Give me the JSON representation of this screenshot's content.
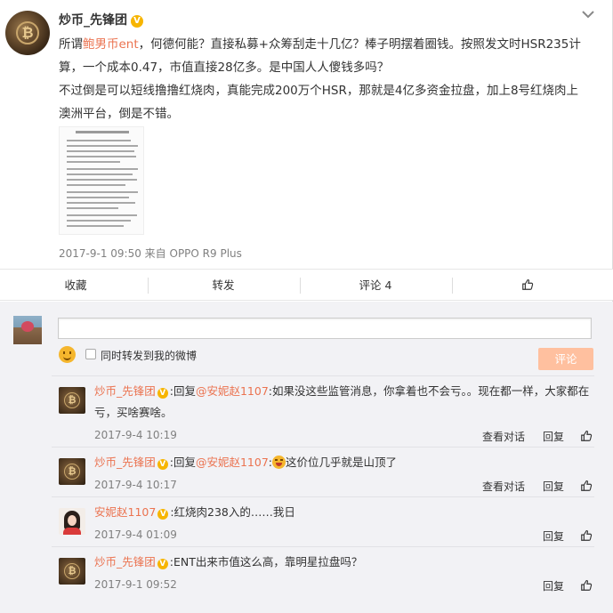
{
  "post": {
    "author": "炒币_先锋团",
    "verified_badge": "V",
    "text_intro": "所谓",
    "text_highlight": "鲍男币ent",
    "text_line1_rest": "，何德何能？直接私募+众筹刮走十几亿？棒子明摆着圈钱。按照发文时HSR235计",
    "text_line2": "算，一个成本0.47，市值直接28亿多。是中国人人傻钱多吗？",
    "text_line3": "不过倒是可以短线撸撸红烧肉，真能完成200万个HSR，那就是4亿多资金拉盘，加上8号红烧肉上",
    "text_line4": "澳洲平台，倒是不错。",
    "meta": "2017-9-1 09:50 来自 OPPO R9 Plus"
  },
  "actions": {
    "favorite": "收藏",
    "repost": "转发",
    "comment": "评论 4"
  },
  "composer": {
    "placeholder": "",
    "forward_label": "同时转发到我的微博",
    "submit_label": "评论"
  },
  "comments": [
    {
      "author": "炒币_先锋团",
      "badge": "V",
      "prefix": ":回复",
      "mention": "@安妮赵1107",
      "line1_rest": ":如果没这些监管消息，你拿着也不会亏。。现在都一样，大家都在",
      "line2": "亏，买啥赛啥。",
      "time": "2017-9-4 10:19",
      "view_thread": "查看对话",
      "reply": "回复"
    },
    {
      "author": "炒币_先锋团",
      "badge": "V",
      "prefix": ":回复",
      "mention": "@安妮赵1107",
      "line1_rest": "这价位几乎就是山顶了",
      "time": "2017-9-4 10:17",
      "view_thread": "查看对话",
      "reply": "回复"
    },
    {
      "author": "安妮赵1107",
      "badge": "V",
      "line1_rest": ":红烧肉238入的……我日",
      "time": "2017-9-4 01:09",
      "reply": "回复"
    },
    {
      "author": "炒币_先锋团",
      "badge": "V",
      "line1_rest": ":ENT出来市值这么高，靠明星拉盘吗？",
      "time": "2017-9-1 09:52",
      "reply": "回复"
    }
  ],
  "colors": {
    "link": "#eb7350",
    "badge": "#f7b500",
    "submit_disabled": "#ffc09f",
    "meta_gray": "#808080"
  },
  "icons": [
    "chevron-down-icon",
    "thumbs-up-icon",
    "emoji-icon",
    "coin-avatar",
    "flower-avatar"
  ]
}
